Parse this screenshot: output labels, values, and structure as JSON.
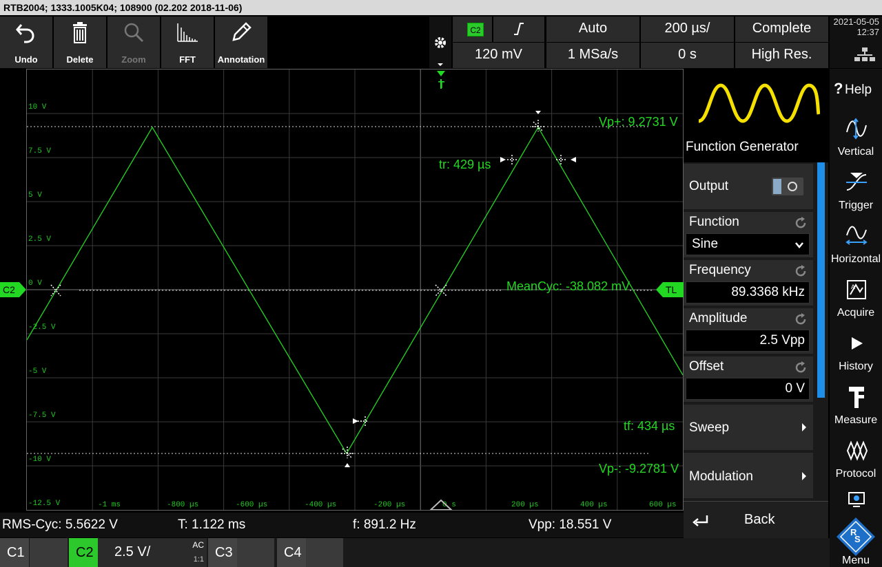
{
  "title": "RTB2004; 1333.1005K04; 108900 (02.202 2018-11-06)",
  "toolbar": [
    {
      "label": "Undo",
      "icon": "undo-icon",
      "enabled": true
    },
    {
      "label": "Delete",
      "icon": "trash-icon",
      "enabled": true
    },
    {
      "label": "Zoom",
      "icon": "zoom-icon",
      "enabled": false
    },
    {
      "label": "FFT",
      "icon": "fft-icon",
      "enabled": true
    },
    {
      "label": "Annotation",
      "icon": "pencil-icon",
      "enabled": true
    }
  ],
  "acq": {
    "channel": "C2",
    "trigger_level": "120 mV",
    "mode": "Auto",
    "sample_rate": "1 MSa/s",
    "timebase": "200 µs/",
    "offset": "0 s",
    "status": "Complete",
    "acq_mode": "High Res."
  },
  "datetime": {
    "date": "2021-05-05",
    "time": "12:37"
  },
  "plot": {
    "y_labels": [
      "10 V",
      "7.5 V",
      "5 V",
      "2.5 V",
      "0 V",
      "-2.5 V",
      "-5 V",
      "-7.5 V",
      "-10 V",
      "-12.5 V"
    ],
    "x_labels": [
      "-1 ms",
      "-800 µs",
      "-600 µs",
      "-400 µs",
      "-200 µs",
      "0 s",
      "200 µs",
      "400 µs",
      "600 µs"
    ],
    "meas_vp_plus": "Vp+: 9.2731 V",
    "meas_vp_minus": "Vp-: -9.2781 V",
    "meas_tr": "tr: 429 µs",
    "meas_tf": "tf: 434 µs",
    "meas_mean": "MeanCyc: -38.082 mV",
    "channel_marker": "C2",
    "trigger_marker": "TL",
    "trigger_top": "T",
    "colors": {
      "trace": "#22d822",
      "grid": "#3a3a3a"
    }
  },
  "fg": {
    "title": "Function Generator",
    "output_label": "Output",
    "function_label": "Function",
    "function_value": "Sine",
    "frequency_label": "Frequency",
    "frequency_value": "89.3368 kHz",
    "amplitude_label": "Amplitude",
    "amplitude_value": "2.5 Vpp",
    "offset_label": "Offset",
    "offset_value": "0 V",
    "sweep_label": "Sweep",
    "modulation_label": "Modulation",
    "back_label": "Back"
  },
  "sidemenu": [
    {
      "label": "Help",
      "icon": "help-icon"
    },
    {
      "label": "Vertical",
      "icon": "vertical-icon"
    },
    {
      "label": "Trigger",
      "icon": "trigger-icon"
    },
    {
      "label": "Horizontal",
      "icon": "horizontal-icon"
    },
    {
      "label": "Acquire",
      "icon": "acquire-icon"
    },
    {
      "label": "History",
      "icon": "play-icon"
    },
    {
      "label": "Measure",
      "icon": "caliper-icon"
    },
    {
      "label": "Protocol",
      "icon": "protocol-icon"
    },
    {
      "label": "Menu",
      "icon": "menu-icon"
    }
  ],
  "measurements": {
    "rms": "RMS-Cyc: 5.5622 V",
    "period": "T: 1.122 ms",
    "freq": "f: 891.2 Hz",
    "vpp": "Vpp: 18.551 V"
  },
  "channels": {
    "c1": "C1",
    "c2": "C2",
    "c2_scale": "2.5 V/",
    "c2_coupling": "AC",
    "c2_probe": "1:1",
    "c3": "C3",
    "c4": "C4"
  }
}
